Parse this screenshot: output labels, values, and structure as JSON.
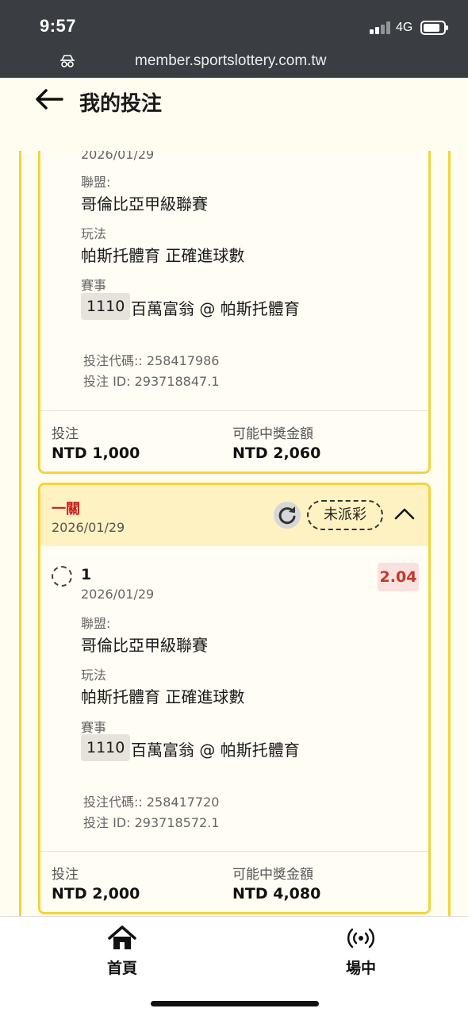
{
  "status_bar": {
    "time": "9:57",
    "network": "4G"
  },
  "browser": {
    "url": "member.sportslottery.com.tw"
  },
  "header": {
    "title": "我的投注"
  },
  "bets": [
    {
      "selection_date": "2026/01/29",
      "league_label": "聯盟:",
      "league": "哥倫比亞甲級聯賽",
      "market_label": "玩法",
      "market": "帕斯托體育 正確進球數",
      "event_label": "賽事",
      "event_code": "1110",
      "event_name": "百萬富翁 @ 帕斯托體育",
      "bet_code": "投注代碼:: 258417986",
      "bet_id": "投注 ID: 293718847.1",
      "stake_label": "投注",
      "stake": "NTD 1,000",
      "payout_label": "可能中獎金額",
      "payout": "NTD 2,060"
    },
    {
      "type": "一關",
      "date": "2026/01/29",
      "status": "未派彩",
      "selection": "1",
      "selection_date": "2026/01/29",
      "odds": "2.04",
      "league_label": "聯盟:",
      "league": "哥倫比亞甲級聯賽",
      "market_label": "玩法",
      "market": "帕斯托體育 正確進球數",
      "event_label": "賽事",
      "event_code": "1110",
      "event_name": "百萬富翁 @ 帕斯托體育",
      "bet_code": "投注代碼:: 258417720",
      "bet_id": "投注 ID: 293718572.1",
      "stake_label": "投注",
      "stake": "NTD 2,000",
      "payout_label": "可能中獎金額",
      "payout": "NTD 4,080"
    }
  ],
  "tabbar": {
    "home_label": "首頁",
    "live_label": "場中"
  },
  "icons": {
    "back": "back-arrow-icon",
    "refresh": "refresh-icon",
    "collapse": "chevron-up-icon",
    "home": "home-icon",
    "live": "live-broadcast-icon"
  },
  "colors": {
    "accent": "#f5d33c",
    "bet_type": "#c81e1e",
    "odds": "#c0392b"
  }
}
